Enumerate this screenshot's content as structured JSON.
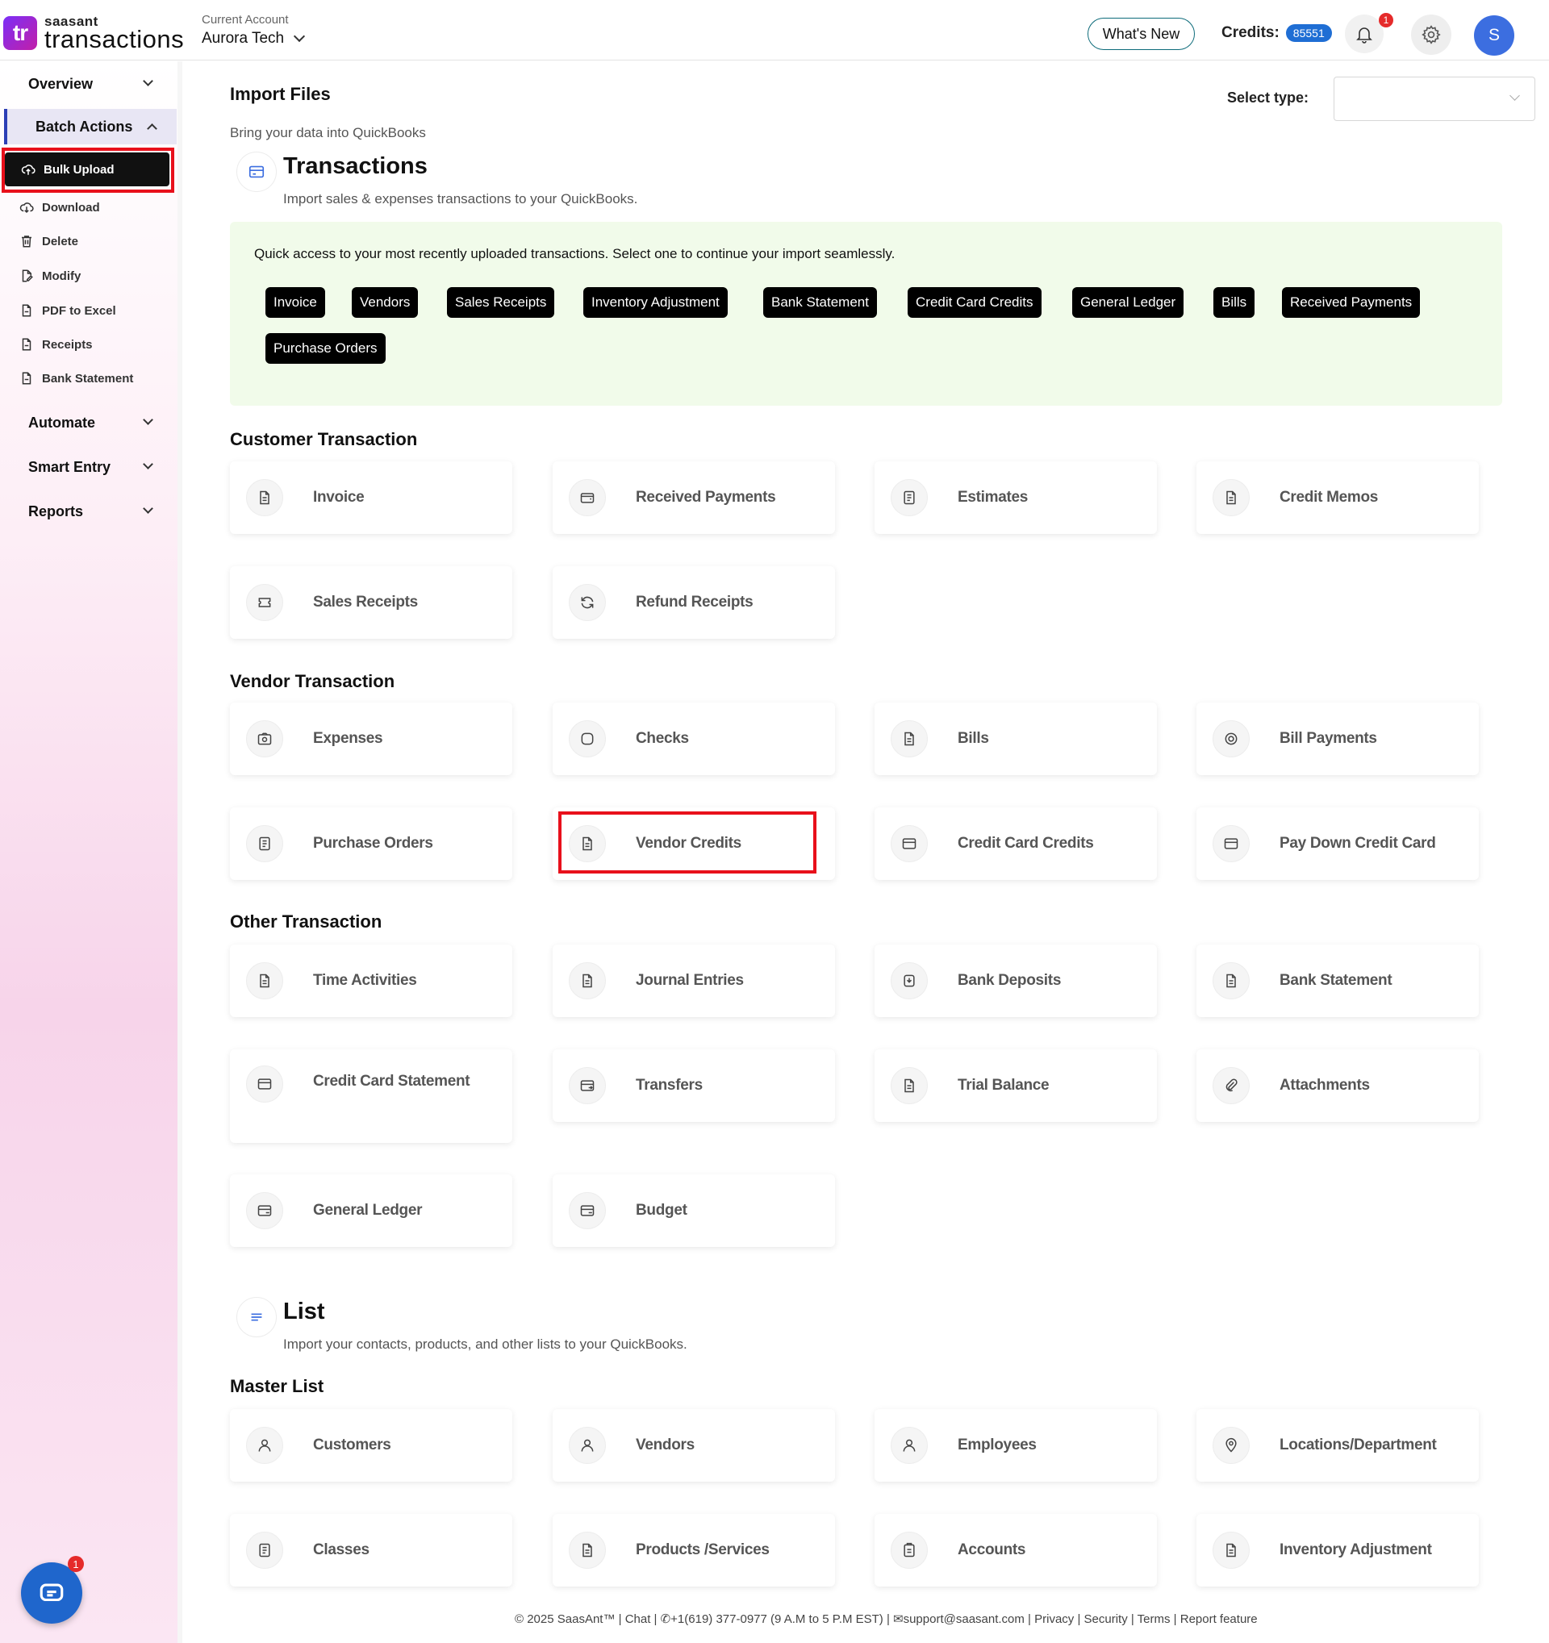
{
  "header": {
    "brand": "saasant",
    "product": "transactions",
    "logo_mark": "tr",
    "account_label": "Current Account",
    "account_name": "Aurora Tech",
    "whats_new": "What's New",
    "credits_label": "Credits:",
    "credits_value": "85551",
    "notification_count": "1",
    "avatar_initial": "S"
  },
  "sidebar": {
    "groups": [
      "Overview",
      "Batch Actions",
      "Automate",
      "Smart Entry",
      "Reports"
    ],
    "batch_items": [
      "Bulk Upload",
      "Download",
      "Delete",
      "Modify",
      "PDF to Excel",
      "Receipts",
      "Bank Statement"
    ]
  },
  "main": {
    "title": "Import Files",
    "subtitle": "Bring your data into QuickBooks",
    "select_type_label": "Select type:",
    "select_type_value": ""
  },
  "transactions": {
    "title": "Transactions",
    "desc": "Import sales & expenses transactions to your QuickBooks.",
    "quick_text": "Quick access to your most recently uploaded transactions. Select one to continue your import seamlessly.",
    "recent": [
      "Invoice",
      "Vendors",
      "Sales Receipts",
      "Inventory Adjustment",
      "Bank Statement",
      "Credit Card Credits",
      "General Ledger",
      "Bills",
      "Received Payments",
      "Purchase Orders"
    ]
  },
  "customer": {
    "title": "Customer Transaction",
    "items": [
      "Invoice",
      "Received Payments",
      "Estimates",
      "Credit Memos",
      "Sales Receipts",
      "Refund Receipts"
    ]
  },
  "vendor": {
    "title": "Vendor Transaction",
    "items": [
      "Expenses",
      "Checks",
      "Bills",
      "Bill Payments",
      "Purchase Orders",
      "Vendor Credits",
      "Credit Card Credits",
      "Pay Down Credit Card"
    ]
  },
  "other": {
    "title": "Other Transaction",
    "items": [
      "Time Activities",
      "Journal Entries",
      "Bank Deposits",
      "Bank Statement",
      "Credit Card Statement",
      "Transfers",
      "Trial Balance",
      "Attachments",
      "General Ledger",
      "Budget"
    ]
  },
  "list": {
    "title": "List",
    "desc": "Import your contacts, products, and other lists to your QuickBooks.",
    "master_title": "Master List",
    "items": [
      "Customers",
      "Vendors",
      "Employees",
      "Locations/Department",
      "Classes",
      "Products /Services",
      "Accounts",
      "Inventory Adjustment"
    ]
  },
  "footer": {
    "text": "© 2025 SaasAnt™  | Chat  |  ✆+1(619) 377-0977 (9 A.M to 5 P.M EST)  |  ✉support@saasant.com  | Privacy  | Security  | Terms  | Report feature"
  },
  "chat": {
    "badge": "1"
  },
  "colors": {
    "accent": "#1f6ed4",
    "highlight": "#e8101b",
    "quick_bg": "#f1fbea"
  }
}
